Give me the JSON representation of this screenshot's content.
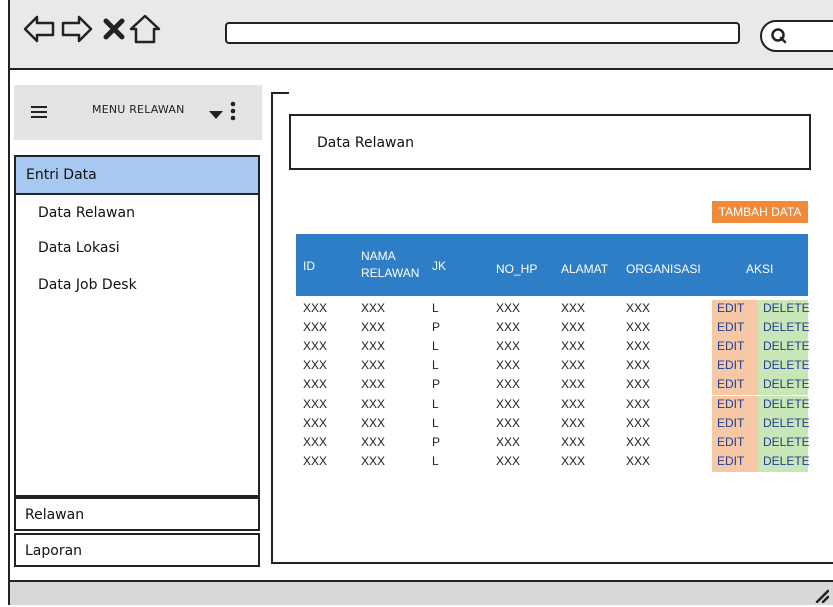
{
  "sidebar": {
    "menu_title": "MENU RELAWAN",
    "active_group": "Entri Data",
    "sub_items": [
      "Data Relawan",
      "Data Lokasi",
      "Data Job Desk"
    ],
    "groups": [
      "Relawan",
      "Laporan"
    ]
  },
  "main": {
    "page_title": "Data Relawan",
    "add_button": "TAMBAH DATA",
    "table": {
      "headers": [
        "ID",
        "NAMA RELAWAN",
        "JK",
        "NO_HP",
        "ALAMAT",
        "ORGANISASI",
        "AKSI"
      ],
      "edit_label": "EDIT",
      "delete_label": "DELETE",
      "rows": [
        [
          "XXX",
          "XXX",
          "L",
          "XXX",
          "XXX",
          "XXX"
        ],
        [
          "XXX",
          "XXX",
          "P",
          "XXX",
          "XXX",
          "XXX"
        ],
        [
          "XXX",
          "XXX",
          "L",
          "XXX",
          "XXX",
          "XXX"
        ],
        [
          "XXX",
          "XXX",
          "L",
          "XXX",
          "XXX",
          "XXX"
        ],
        [
          "XXX",
          "XXX",
          "P",
          "XXX",
          "XXX",
          "XXX"
        ],
        [
          "XXX",
          "XXX",
          "L",
          "XXX",
          "XXX",
          "XXX"
        ],
        [
          "XXX",
          "XXX",
          "L",
          "XXX",
          "XXX",
          "XXX"
        ],
        [
          "XXX",
          "XXX",
          "P",
          "XXX",
          "XXX",
          "XXX"
        ],
        [
          "XXX",
          "XXX",
          "L",
          "XXX",
          "XXX",
          "XXX"
        ]
      ]
    }
  },
  "icons": [
    "back-icon",
    "forward-icon",
    "close-icon",
    "home-icon",
    "search-icon",
    "hamburger-icon",
    "caret-down-icon",
    "more-vertical-icon",
    "resize-grip-icon"
  ],
  "colors": {
    "active_menu": "#a7c8f0",
    "add_button": "#ef8a3b",
    "table_header": "#2e7ec7",
    "edit_cell": "#f6c8a6",
    "delete_cell": "#c9e7b6"
  }
}
